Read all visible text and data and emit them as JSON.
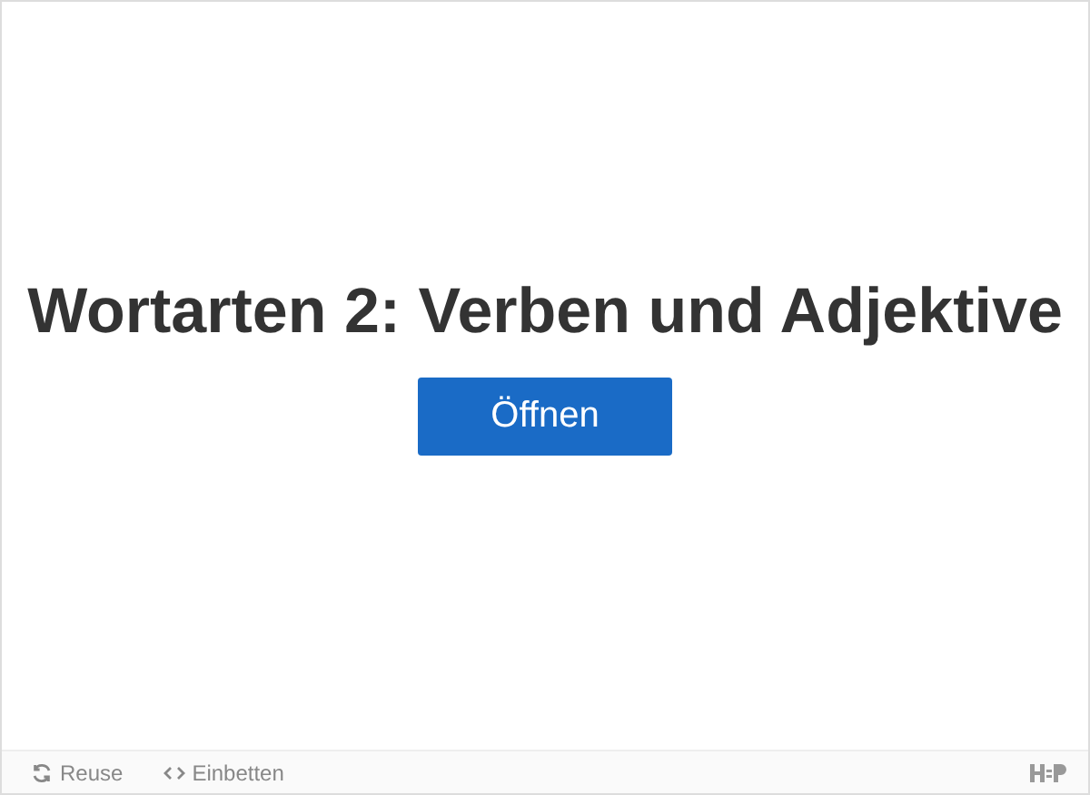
{
  "title": "Wortarten 2: Verben und Adjektive",
  "open_button": "Öffnen",
  "footer": {
    "actions": [
      {
        "kind": "reuse",
        "label": "Reuse"
      },
      {
        "kind": "embed",
        "label": "Einbetten"
      }
    ]
  }
}
